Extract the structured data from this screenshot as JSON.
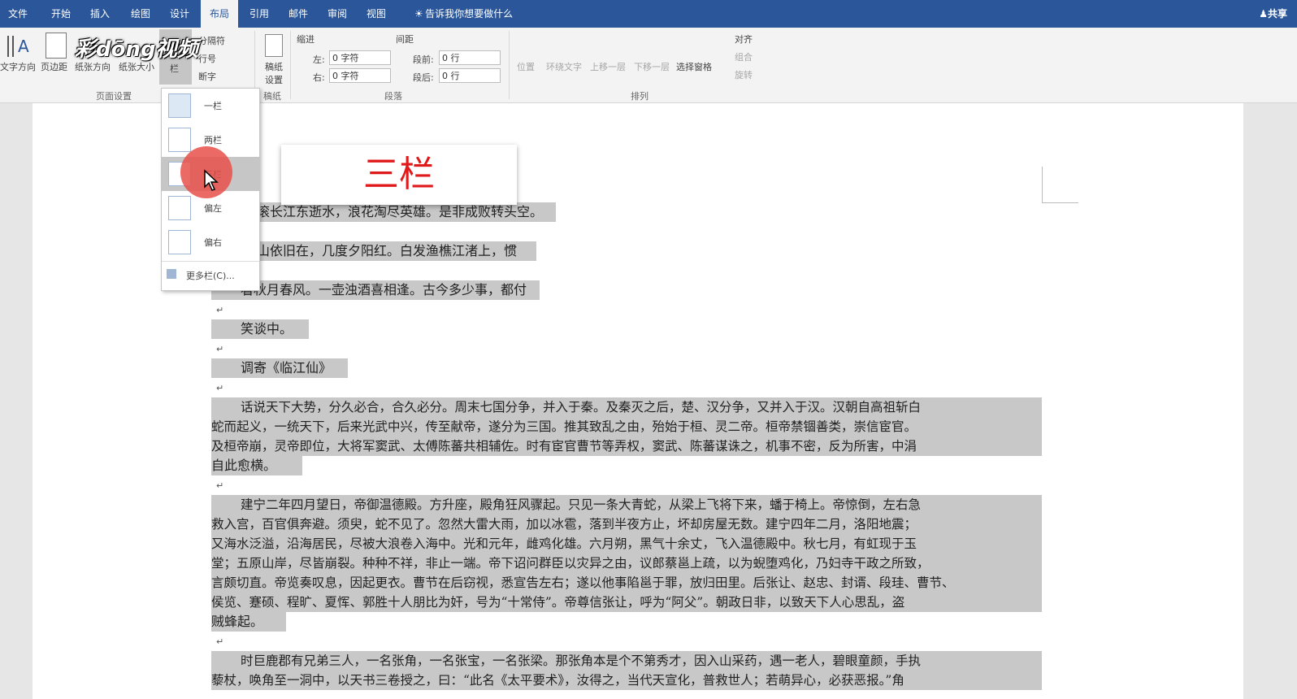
{
  "menu": {
    "tabs": [
      "文件",
      "开始",
      "插入",
      "绘图",
      "设计",
      "布局",
      "引用",
      "邮件",
      "审阅",
      "视图"
    ],
    "active_tab": "布局",
    "tell_me": "告诉我你想要做什么",
    "share": "共享"
  },
  "logo_text": "彩dōng视频",
  "ribbon": {
    "page_setup": {
      "buttons": [
        "文字方向",
        "页边距",
        "纸张方向",
        "纸张大小",
        "栏"
      ],
      "small": [
        "分隔符",
        "行号",
        "断字"
      ],
      "group_label": "页面设置"
    },
    "draft": {
      "button": "稿纸设置",
      "group_label": "稿纸"
    },
    "paragraph": {
      "indent_label": "缩进",
      "spacing_label": "间距",
      "left_label": "左:",
      "left_value": "0 字符",
      "right_label": "右:",
      "right_value": "0 字符",
      "before_label": "段前:",
      "before_value": "0 行",
      "after_label": "段后:",
      "after_value": "0 行",
      "group_label": "段落"
    },
    "arrange": {
      "buttons": [
        "位置",
        "环绕文字",
        "上移一层",
        "下移一层",
        "选择窗格"
      ],
      "small": [
        "对齐",
        "组合",
        "旋转"
      ],
      "group_label": "排列"
    }
  },
  "columns_dropdown": {
    "items": [
      "一栏",
      "两栏",
      "三栏",
      "偏左",
      "偏右"
    ],
    "more": "更多栏(C)..."
  },
  "caption": "三栏",
  "document": {
    "lines": [
      "滚长江东逝水，浪花淘尽英雄。是非成败转头空。",
      "山依旧在，几度夕阳红。白发渔樵江渚上，惯",
      "看秋月春风。一壶浊酒喜相逢。古今多少事，都付",
      "笑谈中。",
      "调寄《临江仙》",
      "话说天下大势，分久必合，合久必分。周末七国分争，并入于秦。及秦灭之后，楚、汉分争，又并入于汉。汉朝自高祖斩白",
      "蛇而起义，一统天下，后来光武中兴，传至献帝，遂分为三国。推其致乱之由，殆始于桓、灵二帝。桓帝禁锢善类，崇信宦官。",
      "及桓帝崩，灵帝即位，大将军窦武、太傅陈蕃共相辅佐。时有宦官曹节等弄权，窦武、陈蕃谋诛之，机事不密，反为所害，中涓",
      "自此愈横。",
      "建宁二年四月望日，帝御温德殿。方升座，殿角狂风骤起。只见一条大青蛇，从梁上飞将下来，蟠于椅上。帝惊倒，左右急",
      "救入宫，百官俱奔避。须臾，蛇不见了。忽然大雷大雨，加以冰雹，落到半夜方止，坏却房屋无数。建宁四年二月，洛阳地震；",
      "又海水泛溢，沿海居民，尽被大浪卷入海中。光和元年，雌鸡化雄。六月朔，黑气十余丈，飞入温德殿中。秋七月，有虹现于玉",
      "堂；五原山岸，尽皆崩裂。种种不祥，非止一端。帝下诏问群臣以灾异之由，议郎蔡邕上疏，以为蜺堕鸡化，乃妇寺干政之所致，",
      "言颇切直。帝览奏叹息，因起更衣。曹节在后窃视，悉宣告左右；遂以他事陷邕于罪，放归田里。后张让、赵忠、封谞、段珪、曹节、",
      "侯览、蹇硕、程旷、夏恽、郭胜十人朋比为奸，号为“十常侍”。帝尊信张让，呼为“阿父”。朝政日非，以致天下人心思乱，盗",
      "贼蜂起。",
      "时巨鹿郡有兄弟三人，一名张角，一名张宝，一名张梁。那张角本是个不第秀才，因入山采药，遇一老人，碧眼童颜，手执",
      "藜杖，唤角至一洞中，以天书三卷授之，曰：“此名《太平要术》，汝得之，当代天宣化，普救世人；若萌异心，必获恶报。”角"
    ]
  }
}
